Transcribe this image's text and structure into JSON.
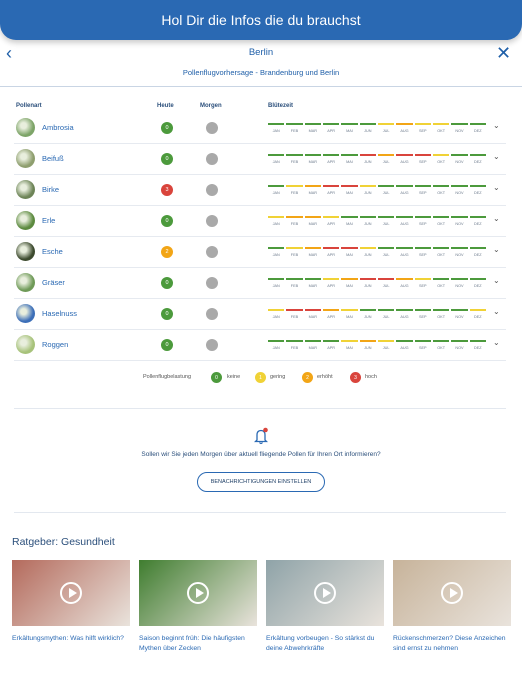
{
  "banner": {
    "title": "Hol Dir die Infos die du brauchst"
  },
  "nav": {
    "back_icon": "‹",
    "close_icon": "✕"
  },
  "header": {
    "city": "Berlin",
    "subtitle": "Pollenflugvorhersage - Brandenburg und Berlin"
  },
  "columns": {
    "plant": "Pollenart",
    "today": "Heute",
    "tomorrow": "Morgen",
    "bloom": "Blütezeit"
  },
  "months": [
    "JAN",
    "FEB",
    "MAR",
    "APR",
    "MAI",
    "JUN",
    "JUL",
    "AUG",
    "SEP",
    "OKT",
    "NOV",
    "DEZ"
  ],
  "colors": {
    "none": "#4c9a3c",
    "low": "#f0d236",
    "medium": "#f2a516",
    "high": "#d9443c",
    "tomorrow": "#a9a9a9",
    "accent": "#2a69b3"
  },
  "plants": [
    {
      "name": "Ambrosia",
      "today_value": "0",
      "today_level": "none",
      "bloom": [
        "none",
        "none",
        "none",
        "none",
        "none",
        "none",
        "low",
        "medium",
        "low",
        "low",
        "none",
        "none"
      ],
      "image_color": "#7da468"
    },
    {
      "name": "Beifuß",
      "today_value": "0",
      "today_level": "none",
      "bloom": [
        "none",
        "none",
        "none",
        "none",
        "none",
        "high",
        "medium",
        "high",
        "high",
        "low",
        "none",
        "none"
      ],
      "image_color": "#8e9e6e"
    },
    {
      "name": "Birke",
      "today_value": "3",
      "today_level": "high",
      "bloom": [
        "none",
        "low",
        "medium",
        "high",
        "high",
        "low",
        "none",
        "none",
        "none",
        "none",
        "none",
        "none"
      ],
      "image_color": "#6d8457"
    },
    {
      "name": "Erle",
      "today_value": "0",
      "today_level": "none",
      "bloom": [
        "low",
        "medium",
        "medium",
        "low",
        "none",
        "none",
        "none",
        "none",
        "none",
        "none",
        "none",
        "none"
      ],
      "image_color": "#5c8a3f"
    },
    {
      "name": "Esche",
      "today_value": "2",
      "today_level": "medium",
      "bloom": [
        "none",
        "low",
        "medium",
        "high",
        "high",
        "low",
        "none",
        "none",
        "none",
        "none",
        "none",
        "none"
      ],
      "image_color": "#3c4a2e"
    },
    {
      "name": "Gräser",
      "today_value": "0",
      "today_level": "none",
      "bloom": [
        "none",
        "none",
        "none",
        "low",
        "medium",
        "high",
        "high",
        "medium",
        "low",
        "none",
        "none",
        "none"
      ],
      "image_color": "#6f9a58"
    },
    {
      "name": "Haselnuss",
      "today_value": "0",
      "today_level": "none",
      "bloom": [
        "low",
        "high",
        "high",
        "medium",
        "low",
        "none",
        "none",
        "none",
        "none",
        "none",
        "none",
        "low"
      ],
      "image_color": "#3d6fb8"
    },
    {
      "name": "Roggen",
      "today_value": "0",
      "today_level": "none",
      "bloom": [
        "none",
        "none",
        "none",
        "none",
        "low",
        "medium",
        "low",
        "none",
        "none",
        "none",
        "none",
        "none"
      ],
      "image_color": "#a7c27a"
    }
  ],
  "legend": {
    "title": "Pollenflugbelastung",
    "items": [
      {
        "value": "0",
        "label": "keine",
        "level": "none"
      },
      {
        "value": "1",
        "label": "gering",
        "level": "low"
      },
      {
        "value": "2",
        "label": "erhöht",
        "level": "medium"
      },
      {
        "value": "3",
        "label": "hoch",
        "level": "high"
      }
    ]
  },
  "notification": {
    "icon": "bell-icon",
    "text": "Sollen wir Sie jeden Morgen über aktuell fliegende Pollen für Ihren Ort informieren?",
    "button": "BENACHRICHTIGUNGEN EINSTELLEN"
  },
  "ratgeber": {
    "title": "Ratgeber: Gesundheit",
    "articles": [
      {
        "title": "Erkältungsmythen: Was hilft wirklich?",
        "image_color": "#b46a5c"
      },
      {
        "title": "Saison beginnt früh: Die häufigsten Mythen über Zecken",
        "image_color": "#3f7d2f"
      },
      {
        "title": "Erkältung vorbeugen - So stärkst du deine Abwehrkräfte",
        "image_color": "#8fa3a8"
      },
      {
        "title": "Rückenschmerzen? Diese Anzeichen sind ernst zu nehmen",
        "image_color": "#c7b39a"
      }
    ]
  }
}
